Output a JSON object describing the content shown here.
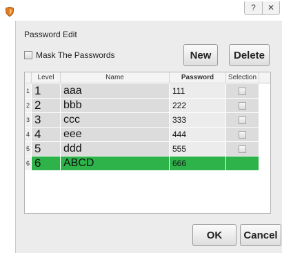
{
  "window": {
    "help_glyph": "?",
    "close_glyph": "✕"
  },
  "dialog": {
    "group_title": "Password Edit",
    "mask_label": "Mask The Passwords",
    "buttons": {
      "new": "New",
      "delete": "Delete",
      "ok": "OK",
      "cancel": "Cancel"
    }
  },
  "table": {
    "columns": [
      "Level",
      "Name",
      "Password",
      "Selection"
    ],
    "rows": [
      {
        "rownum": "1",
        "level": "1",
        "name": "aaa",
        "password": "111",
        "selection": false
      },
      {
        "rownum": "2",
        "level": "2",
        "name": "bbb",
        "password": "222",
        "selection": false
      },
      {
        "rownum": "3",
        "level": "3",
        "name": "ccc",
        "password": "333",
        "selection": false
      },
      {
        "rownum": "4",
        "level": "4",
        "name": "eee",
        "password": "444",
        "selection": false
      },
      {
        "rownum": "5",
        "level": "5",
        "name": "ddd",
        "password": "555",
        "selection": false
      },
      {
        "rownum": "6",
        "level": "6",
        "name": "ABCD",
        "password": "666",
        "selection": null,
        "selected": true
      }
    ]
  },
  "colors": {
    "selected_row": "#2db34a",
    "cell_bg": "#dcdcdc",
    "dialog_bg": "#ececec",
    "app_icon": "#e07a1f"
  },
  "icons": {
    "app": "shield-icon",
    "help": "help-icon",
    "close": "close-icon"
  }
}
